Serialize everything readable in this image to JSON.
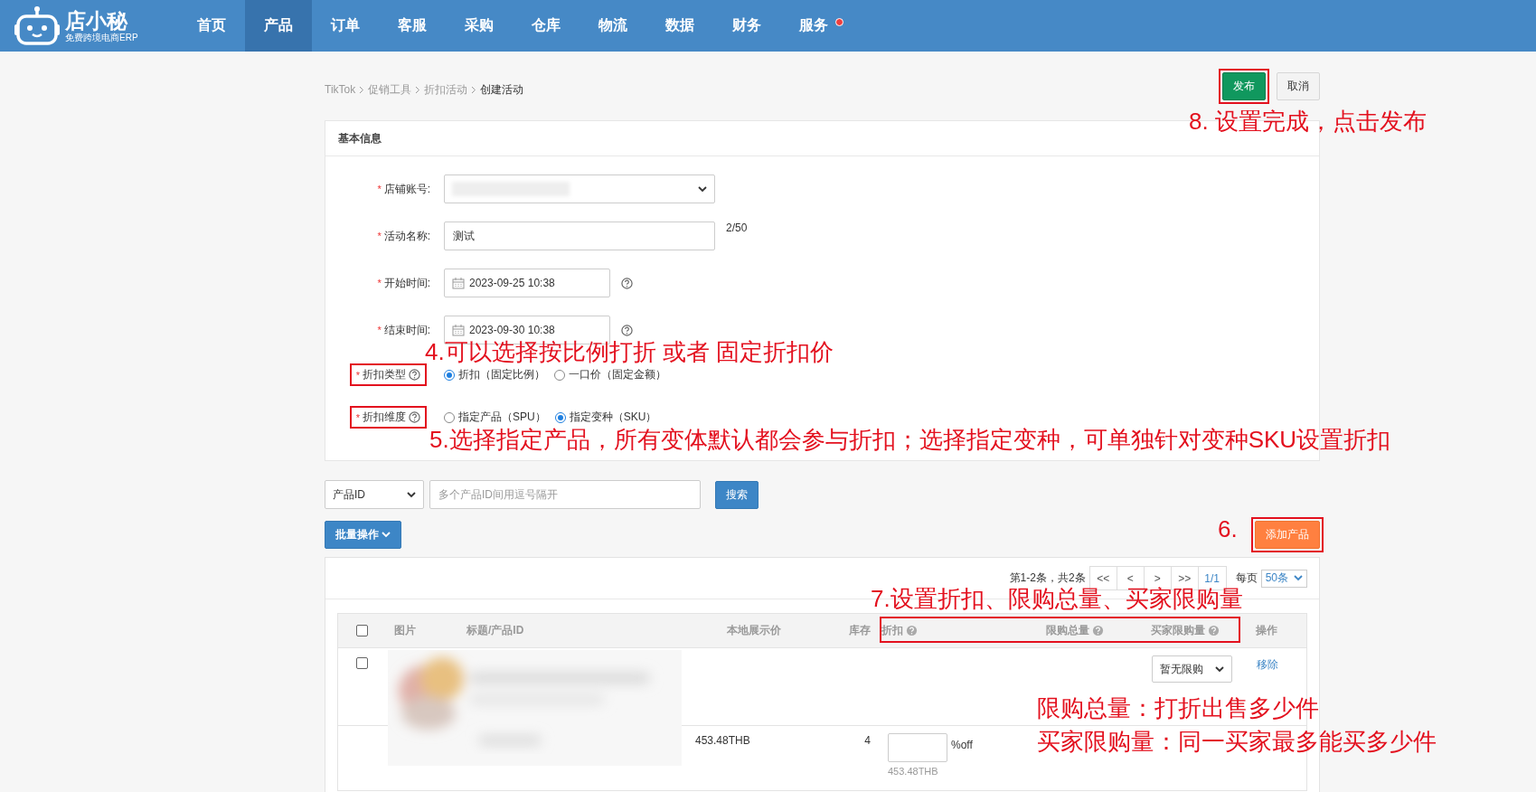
{
  "nav": {
    "logo": {
      "name": "店小秘",
      "tagline": "免费跨境电商ERP"
    },
    "items": [
      {
        "label": "首页",
        "selected": false,
        "badge": false
      },
      {
        "label": "产品",
        "selected": true,
        "badge": false
      },
      {
        "label": "订单",
        "selected": false,
        "badge": false
      },
      {
        "label": "客服",
        "selected": false,
        "badge": false
      },
      {
        "label": "采购",
        "selected": false,
        "badge": false
      },
      {
        "label": "仓库",
        "selected": false,
        "badge": false
      },
      {
        "label": "物流",
        "selected": false,
        "badge": false
      },
      {
        "label": "数据",
        "selected": false,
        "badge": false
      },
      {
        "label": "财务",
        "selected": false,
        "badge": false
      },
      {
        "label": "服务",
        "selected": false,
        "badge": true
      }
    ]
  },
  "breadcrumb": [
    {
      "label": "TikTok",
      "current": false
    },
    {
      "label": "促销工具",
      "current": false
    },
    {
      "label": "折扣活动",
      "current": false
    },
    {
      "label": "创建活动",
      "current": true
    }
  ],
  "actions": [
    {
      "label": "发布",
      "kind": "primary",
      "highlighted": true
    },
    {
      "label": "取消",
      "kind": "default",
      "highlighted": false
    }
  ],
  "basic_info": {
    "title": "基本信息",
    "fields": [
      {
        "kind": "select",
        "mark": "*",
        "label": "店铺账号:",
        "highlighted": false
      },
      {
        "kind": "text",
        "mark": "*",
        "label": "活动名称:",
        "value": "测试",
        "counter": "2/50",
        "highlighted": false
      },
      {
        "kind": "date",
        "mark": "*",
        "label": "开始时间:",
        "value": "2023-09-25 10:38",
        "help": true,
        "highlighted": false
      },
      {
        "kind": "date",
        "mark": "*",
        "label": "结束时间:",
        "value": "2023-09-30 10:38",
        "help": true,
        "highlighted": false
      },
      {
        "kind": "radio",
        "mark": "*",
        "label": "折扣类型",
        "help": true,
        "highlighted": true,
        "options": [
          {
            "label": "折扣（固定比例）",
            "selected": true
          },
          {
            "label": "一口价（固定金额）",
            "selected": false
          }
        ]
      },
      {
        "kind": "radio",
        "mark": "*",
        "label": "折扣维度",
        "help": true,
        "highlighted": true,
        "options": [
          {
            "label": "指定产品（SPU）",
            "selected": false
          },
          {
            "label": "指定变种（SKU）",
            "selected": true
          }
        ]
      }
    ]
  },
  "search": {
    "filter": "产品ID",
    "placeholder": "多个产品ID间用逗号隔开",
    "button": "搜索"
  },
  "batch_button": "批量操作",
  "add_button": {
    "label": "添加产品",
    "highlighted": true
  },
  "pagination": {
    "summary": "第1-2条，共2条",
    "buttons": [
      "<<",
      "<",
      ">",
      ">>"
    ],
    "page": "1/1",
    "per_page_label": "每页",
    "per_page": "50条"
  },
  "table": {
    "header_checked": false,
    "columns_highlighted": true,
    "columns": [
      {
        "label": "图片",
        "help": false
      },
      {
        "label": "标题/产品ID",
        "help": false
      },
      {
        "label": "本地展示价",
        "help": false
      },
      {
        "label": "库存",
        "help": false
      },
      {
        "label": "折扣",
        "help": true
      },
      {
        "label": "限购总量",
        "help": true
      },
      {
        "label": "买家限购量",
        "help": true
      },
      {
        "label": "操作",
        "help": false
      }
    ],
    "product": {
      "checked": false,
      "buyer_limit": "暂无限购",
      "action": "移除"
    },
    "variant": {
      "price": "453.48THB",
      "stock": "4",
      "discount_suffix": "%off",
      "discounted_price": "453.48THB"
    }
  },
  "annotations": [
    {
      "text": "8. 设置完成，点击发布"
    },
    {
      "text": "4.可以选择按比例打折 或者 固定折扣价"
    },
    {
      "text": "5.选择指定产品，所有变体默认都会参与折扣；选择指定变种，可单独针对变种SKU设置折扣"
    },
    {
      "text": "6."
    },
    {
      "text": "7.设置折扣、限购总量、买家限购量"
    },
    {
      "text": "限购总量：打折出售多少件"
    },
    {
      "text": "买家限购量：同一买家最多能买多少件"
    }
  ]
}
